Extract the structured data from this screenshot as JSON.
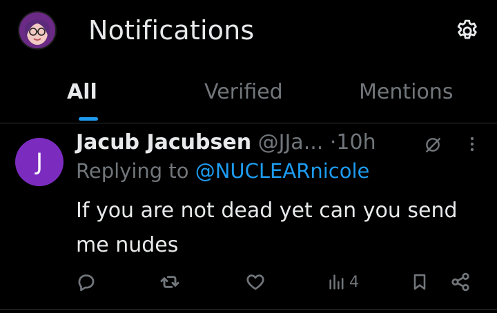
{
  "header": {
    "title": "Notifications"
  },
  "tabs": [
    {
      "label": "All",
      "active": true
    },
    {
      "label": "Verified",
      "active": false
    },
    {
      "label": "Mentions",
      "active": false
    }
  ],
  "tweet": {
    "avatar_initial": "J",
    "display_name": "Jacub Jacubsen",
    "handle": "@JJa...",
    "separator": "·",
    "time": "10h",
    "reply_prefix": "Replying to",
    "reply_to": "@NUCLEARnicole",
    "text": "If you are not dead yet can you send me nudes",
    "views": "4"
  },
  "icons": {
    "settings": "gear-icon",
    "reply": "comment-icon",
    "retweet": "retweet-icon",
    "like": "heart-icon",
    "views": "analytics-icon",
    "bookmark": "bookmark-icon",
    "share": "share-icon",
    "more": "more-vertical-icon",
    "grok": "grok-icon"
  },
  "colors": {
    "background": "#000000",
    "accent": "#1d9bf0",
    "muted": "#71767b",
    "text": "#e7e9ea",
    "avatar_bg": "#7b2cbf"
  }
}
